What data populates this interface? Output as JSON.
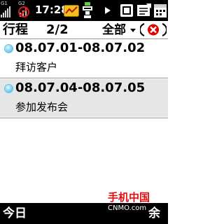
{
  "status_bar": {
    "signal_1_label": "G1",
    "signal_2_label": "G2",
    "time": "17:28",
    "icons": [
      "signal-strength-icon",
      "no-signal-icon",
      "missed-call-icon",
      "network-data-icon",
      "play-icon",
      "battery-icon",
      "message-icon",
      "calendar-icon"
    ]
  },
  "header": {
    "title": "行程",
    "page": "2/2",
    "filter_label": "全部",
    "close_icon": "close-icon"
  },
  "appointments": [
    {
      "date_range": "08.07.01-08.07.02",
      "subject": "拜访客户",
      "bullet_icon": "appointment-bullet-icon"
    },
    {
      "date_range": "08.07.04-08.07.05",
      "subject": "参加发布会",
      "bullet_icon": "appointment-bullet-icon"
    }
  ],
  "softkeys": {
    "left": "今日",
    "right": "余"
  },
  "watermark": {
    "brand": "手机中国",
    "site": "CNMO.com"
  },
  "colors": {
    "status_bar_bg": "#000000",
    "selected_row_bg": "#e6e6e6",
    "bullet": "#5bc0eb",
    "close_accent": "#e00000"
  }
}
